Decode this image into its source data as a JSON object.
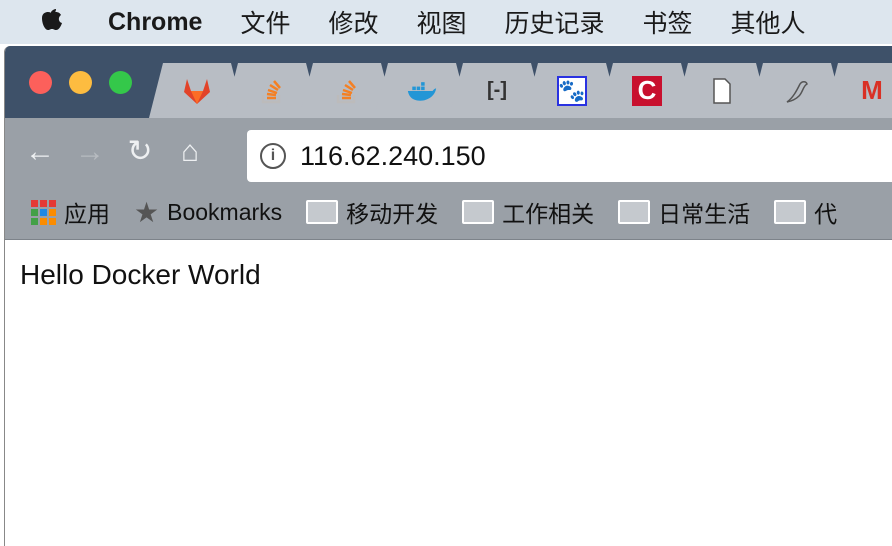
{
  "menubar": {
    "apple": "",
    "app": "Chrome",
    "items": [
      "文件",
      "修改",
      "视图",
      "历史记录",
      "书签",
      "其他人"
    ]
  },
  "tabs": [
    {
      "icon": "gitlab-icon"
    },
    {
      "icon": "stackoverflow-icon"
    },
    {
      "icon": "stackoverflow-icon"
    },
    {
      "icon": "docker-icon"
    },
    {
      "icon": "aliyun-icon",
      "glyph": "[-]"
    },
    {
      "icon": "baidu-paw-icon"
    },
    {
      "icon": "c-logo-icon",
      "glyph": "C"
    },
    {
      "icon": "document-icon"
    },
    {
      "icon": "bird-icon"
    },
    {
      "icon": "gmail-icon",
      "glyph": "M"
    }
  ],
  "toolbar": {
    "url": "116.62.240.150"
  },
  "bookmarks": {
    "apps": "应用",
    "bookmarks": "Bookmarks",
    "folders": [
      "移动开发",
      "工作相关",
      "日常生活",
      "代"
    ]
  },
  "page": {
    "text": "Hello Docker World"
  },
  "colors": {
    "tabstrip": "#3e5169",
    "tab": "#b8bdc4",
    "toolbar": "#9aa0a7",
    "close": "#fc605b",
    "minimize": "#fdbc40",
    "zoom": "#34c84a"
  }
}
